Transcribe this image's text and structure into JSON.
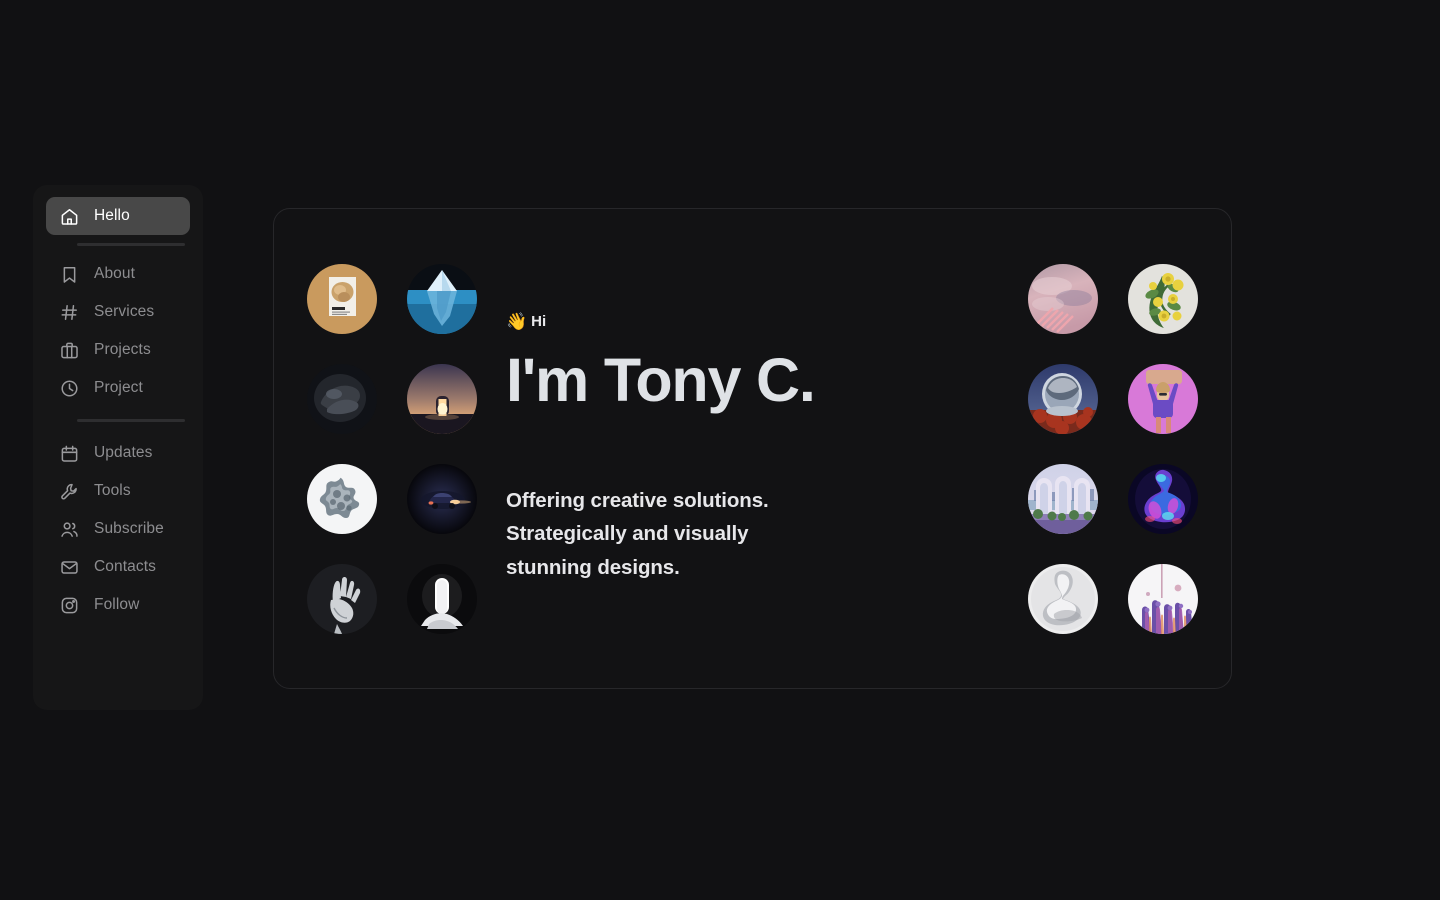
{
  "page": {
    "background_color": "#111113",
    "card_background": "#121214",
    "card_border_color": "#27272a"
  },
  "sidebar": {
    "background_color": "#161617",
    "active_item_background": "#484848",
    "active_text_color": "#ffffff",
    "inactive_text_color": "#8d8d90",
    "groups": [
      {
        "items": [
          {
            "label": "Hello",
            "icon": "home-icon",
            "active": true
          }
        ]
      },
      {
        "items": [
          {
            "label": "About",
            "icon": "bookmark-icon",
            "active": false
          },
          {
            "label": "Services",
            "icon": "hash-icon",
            "active": false
          },
          {
            "label": "Projects",
            "icon": "briefcase-icon",
            "active": false
          },
          {
            "label": "Project",
            "icon": "clock-icon",
            "active": false
          }
        ]
      },
      {
        "items": [
          {
            "label": "Updates",
            "icon": "calendar-icon",
            "active": false
          },
          {
            "label": "Tools",
            "icon": "wrench-icon",
            "active": false
          },
          {
            "label": "Subscribe",
            "icon": "users-icon",
            "active": false
          },
          {
            "label": "Contacts",
            "icon": "mail-icon",
            "active": false
          },
          {
            "label": "Follow",
            "icon": "instagram-icon",
            "active": false
          }
        ]
      }
    ]
  },
  "hero": {
    "wave_emoji": "👋",
    "greeting": "Hi",
    "title": "I'm Tony C.",
    "subtitle_lines": [
      "Offering creative solutions.",
      "Strategically and visually",
      "stunning designs."
    ]
  },
  "gallery": {
    "left": [
      {
        "name": "venus-poster-thumbnail",
        "description": "Tan poster titled VENUS with a textured sphere"
      },
      {
        "name": "iceberg-thumbnail",
        "description": "Iceberg above and below blue water"
      },
      {
        "name": "dark-abstract-form-thumbnail",
        "description": "Dark grey abstract sculptural form"
      },
      {
        "name": "sunset-doorway-thumbnail",
        "description": "Glowing doorway on a desert horizon at sunset"
      },
      {
        "name": "white-coral-thumbnail",
        "description": "Grey coral cluster on a white circle"
      },
      {
        "name": "night-car-thumbnail",
        "description": "Dark car with headlights on a black background"
      },
      {
        "name": "silver-hand-thumbnail",
        "description": "Metallic open hand sculpture"
      },
      {
        "name": "white-arch-light-thumbnail",
        "description": "Glowing white arch over draped fabric"
      }
    ],
    "right": [
      {
        "name": "pink-sky-thumbnail",
        "description": "Pink clouded sky with striped pattern"
      },
      {
        "name": "yellow-flowers-thumbnail",
        "description": "Yellow roses with green leaves on grey"
      },
      {
        "name": "astronaut-helmet-thumbnail",
        "description": "Chrome astronaut helmet over red rocks"
      },
      {
        "name": "purple-figure-thumbnail",
        "description": "Cartoon figure raising a slab on pink"
      },
      {
        "name": "arches-landscape-thumbnail",
        "description": "Pastel arches over a lake landscape"
      },
      {
        "name": "neon-bust-thumbnail",
        "description": "Neon purple classical bust on dark blue"
      },
      {
        "name": "white-statue-thumbnail",
        "description": "White marble torso sculpture"
      },
      {
        "name": "purple-drip-thumbnail",
        "description": "Purple dripping paint forms on white"
      }
    ]
  }
}
